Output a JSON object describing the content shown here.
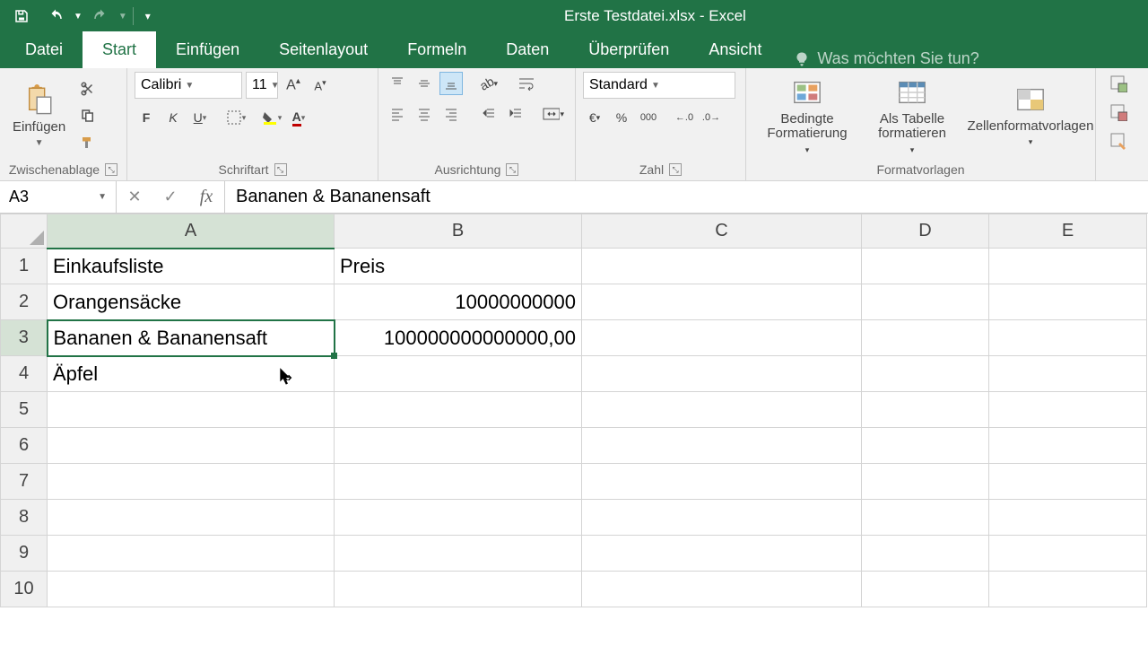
{
  "app": {
    "title": "Erste Testdatei.xlsx - Excel"
  },
  "qat": {
    "save": "save",
    "undo": "undo",
    "redo": "redo"
  },
  "tabs": {
    "file": "Datei",
    "home": "Start",
    "insert": "Einfügen",
    "pagelayout": "Seitenlayout",
    "formulas": "Formeln",
    "data": "Daten",
    "review": "Überprüfen",
    "view": "Ansicht",
    "tellme": "Was möchten Sie tun?"
  },
  "ribbon": {
    "clipboard": {
      "label": "Zwischenablage",
      "paste": "Einfügen"
    },
    "font": {
      "label": "Schriftart",
      "name": "Calibri",
      "size": "11",
      "bold": "F",
      "italic": "K",
      "underline": "U"
    },
    "alignment": {
      "label": "Ausrichtung"
    },
    "number": {
      "label": "Zahl",
      "format": "Standard"
    },
    "styles": {
      "label": "Formatvorlagen",
      "cond": "Bedingte Formatierung",
      "table": "Als Tabelle formatieren",
      "cell": "Zellenformatvorlagen"
    }
  },
  "namebox": {
    "ref": "A3"
  },
  "formula": {
    "value": "Bananen & Bananensaft"
  },
  "columns": [
    "A",
    "B",
    "C",
    "D",
    "E"
  ],
  "rows": [
    "1",
    "2",
    "3",
    "4",
    "5",
    "6",
    "7",
    "8",
    "9",
    "10"
  ],
  "cells": {
    "A1": "Einkaufsliste",
    "B1": "Preis",
    "A2": "Orangensäcke",
    "B2": "10000000000",
    "A3": "Bananen & Bananensaft",
    "B3": "100000000000000,00",
    "A4": "Äpfel"
  },
  "selection": {
    "cell": "A3",
    "col": "A",
    "row": "3"
  },
  "chart_data": null
}
